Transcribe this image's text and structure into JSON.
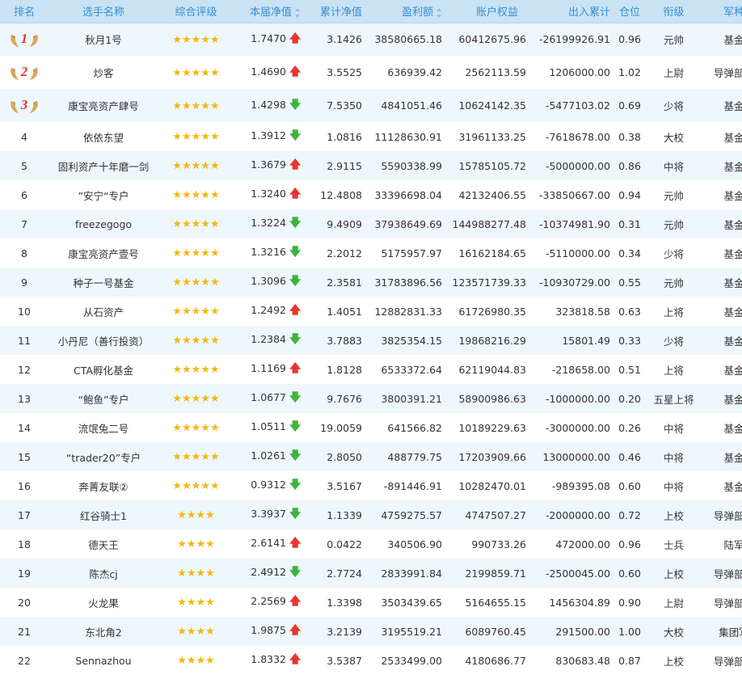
{
  "header": {
    "rank": "排名",
    "name": "选手名称",
    "rating": "综合评级",
    "nav": "本届净值",
    "cum_nav": "累计净值",
    "profit": "盈利额",
    "equity": "账户权益",
    "in_out": "出入累计",
    "position": "仓位",
    "title": "衔级",
    "branch": "军种"
  },
  "colors": {
    "header_bg": "#c9e3f4",
    "header_text": "#3a8fcf",
    "up": "#e8362f",
    "down": "#3db43d",
    "star": "#f4b70e",
    "stripe": "#eef7fc"
  },
  "icons": {
    "up": "arrow-up-icon",
    "down": "arrow-down-icon",
    "medal": "laurel-medal-icon",
    "star": "star-icon"
  },
  "rows": [
    {
      "rank": "1",
      "name": "秋月1号",
      "stars": "★★★★★",
      "nav": "1.7470",
      "trend": "up",
      "cum": "3.1426",
      "profit": "38580665.18",
      "equity": "60412675.96",
      "inout": "-26199926.91",
      "pos": "0.96",
      "title": "元帅",
      "branch": "基金"
    },
    {
      "rank": "2",
      "name": "炒客",
      "stars": "★★★★★",
      "nav": "1.4690",
      "trend": "up",
      "cum": "3.5525",
      "profit": "636939.42",
      "equity": "2562113.59",
      "inout": "1206000.00",
      "pos": "1.02",
      "title": "上尉",
      "branch": "导弹部队"
    },
    {
      "rank": "3",
      "name": "康宝亮资产肆号",
      "stars": "★★★★★",
      "nav": "1.4298",
      "trend": "down",
      "cum": "7.5350",
      "profit": "4841051.46",
      "equity": "10624142.35",
      "inout": "-5477103.02",
      "pos": "0.69",
      "title": "少将",
      "branch": "基金"
    },
    {
      "rank": "4",
      "name": "依依东望",
      "stars": "★★★★★",
      "nav": "1.3912",
      "trend": "down",
      "cum": "1.0816",
      "profit": "11128630.91",
      "equity": "31961133.25",
      "inout": "-7618678.00",
      "pos": "0.38",
      "title": "大校",
      "branch": "基金"
    },
    {
      "rank": "5",
      "name": "固利资产十年磨一剑",
      "stars": "★★★★★",
      "nav": "1.3679",
      "trend": "up",
      "cum": "2.9115",
      "profit": "5590338.99",
      "equity": "15785105.72",
      "inout": "-5000000.00",
      "pos": "0.86",
      "title": "中将",
      "branch": "基金"
    },
    {
      "rank": "6",
      "name": "”安宁“专户",
      "stars": "★★★★★",
      "nav": "1.3240",
      "trend": "up",
      "cum": "12.4808",
      "profit": "33396698.04",
      "equity": "42132406.55",
      "inout": "-33850667.00",
      "pos": "0.94",
      "title": "元帅",
      "branch": "基金"
    },
    {
      "rank": "7",
      "name": "freezegogo",
      "stars": "★★★★★",
      "nav": "1.3224",
      "trend": "down",
      "cum": "9.4909",
      "profit": "37938649.69",
      "equity": "144988277.48",
      "inout": "-10374981.90",
      "pos": "0.31",
      "title": "元帅",
      "branch": "基金"
    },
    {
      "rank": "8",
      "name": "康宝亮资产壹号",
      "stars": "★★★★★",
      "nav": "1.3216",
      "trend": "down",
      "cum": "2.2012",
      "profit": "5175957.97",
      "equity": "16162184.65",
      "inout": "-5110000.00",
      "pos": "0.34",
      "title": "少将",
      "branch": "基金"
    },
    {
      "rank": "9",
      "name": "种子一号基金",
      "stars": "★★★★★",
      "nav": "1.3096",
      "trend": "down",
      "cum": "2.3581",
      "profit": "31783896.56",
      "equity": "123571739.33",
      "inout": "-10930729.00",
      "pos": "0.55",
      "title": "元帅",
      "branch": "基金"
    },
    {
      "rank": "10",
      "name": "从石资产",
      "stars": "★★★★★",
      "nav": "1.2492",
      "trend": "up",
      "cum": "1.4051",
      "profit": "12882831.33",
      "equity": "61726980.35",
      "inout": "323818.58",
      "pos": "0.63",
      "title": "上将",
      "branch": "基金"
    },
    {
      "rank": "11",
      "name": "小丹尼（善行投资）",
      "stars": "★★★★★",
      "nav": "1.2384",
      "trend": "down",
      "cum": "3.7883",
      "profit": "3825354.15",
      "equity": "19868216.29",
      "inout": "15801.49",
      "pos": "0.33",
      "title": "少将",
      "branch": "基金"
    },
    {
      "rank": "12",
      "name": "CTA孵化基金",
      "stars": "★★★★★",
      "nav": "1.1169",
      "trend": "up",
      "cum": "1.8128",
      "profit": "6533372.64",
      "equity": "62119044.83",
      "inout": "-218658.00",
      "pos": "0.51",
      "title": "上将",
      "branch": "基金"
    },
    {
      "rank": "13",
      "name": "“鲍鱼”专户",
      "stars": "★★★★★",
      "nav": "1.0677",
      "trend": "down",
      "cum": "9.7676",
      "profit": "3800391.21",
      "equity": "58900986.63",
      "inout": "-1000000.00",
      "pos": "0.20",
      "title": "五星上将",
      "branch": "基金"
    },
    {
      "rank": "14",
      "name": "流氓兔二号",
      "stars": "★★★★★",
      "nav": "1.0511",
      "trend": "down",
      "cum": "19.0059",
      "profit": "641566.82",
      "equity": "10189229.63",
      "inout": "-3000000.00",
      "pos": "0.26",
      "title": "中将",
      "branch": "基金"
    },
    {
      "rank": "15",
      "name": "“trader20”专户",
      "stars": "★★★★★",
      "nav": "1.0261",
      "trend": "down",
      "cum": "2.8050",
      "profit": "488779.75",
      "equity": "17203909.66",
      "inout": "13000000.00",
      "pos": "0.46",
      "title": "中将",
      "branch": "基金"
    },
    {
      "rank": "16",
      "name": "奔菁友联②",
      "stars": "★★★★★",
      "nav": "0.9312",
      "trend": "down",
      "cum": "3.5167",
      "profit": "-891446.91",
      "equity": "10282470.01",
      "inout": "-989395.08",
      "pos": "0.60",
      "title": "中将",
      "branch": "基金"
    },
    {
      "rank": "17",
      "name": "红谷骑士1",
      "stars": "★★★★",
      "nav": "3.3937",
      "trend": "down",
      "cum": "1.1339",
      "profit": "4759275.57",
      "equity": "4747507.27",
      "inout": "-2000000.00",
      "pos": "0.72",
      "title": "上校",
      "branch": "导弹部队"
    },
    {
      "rank": "18",
      "name": "德天王",
      "stars": "★★★★",
      "nav": "2.6141",
      "trend": "up",
      "cum": "0.0422",
      "profit": "340506.90",
      "equity": "990733.26",
      "inout": "472000.00",
      "pos": "0.96",
      "title": "士兵",
      "branch": "陆军"
    },
    {
      "rank": "19",
      "name": "陈杰cj",
      "stars": "★★★★",
      "nav": "2.4912",
      "trend": "down",
      "cum": "2.7724",
      "profit": "2833991.84",
      "equity": "2199859.71",
      "inout": "-2500045.00",
      "pos": "0.60",
      "title": "上校",
      "branch": "导弹部队"
    },
    {
      "rank": "20",
      "name": "火龙果",
      "stars": "★★★★",
      "nav": "2.2569",
      "trend": "up",
      "cum": "1.3398",
      "profit": "3503439.65",
      "equity": "5164655.15",
      "inout": "1456304.89",
      "pos": "0.90",
      "title": "上尉",
      "branch": "导弹部队"
    },
    {
      "rank": "21",
      "name": "东北角2",
      "stars": "★★★★",
      "nav": "1.9875",
      "trend": "up",
      "cum": "3.2139",
      "profit": "3195519.21",
      "equity": "6089760.45",
      "inout": "291500.00",
      "pos": "1.00",
      "title": "大校",
      "branch": "集团军"
    },
    {
      "rank": "22",
      "name": "Sennazhou",
      "stars": "★★★★",
      "nav": "1.8332",
      "trend": "up",
      "cum": "3.5387",
      "profit": "2533499.00",
      "equity": "4180686.77",
      "inout": "830683.48",
      "pos": "0.87",
      "title": "上校",
      "branch": "导弹部队"
    }
  ]
}
